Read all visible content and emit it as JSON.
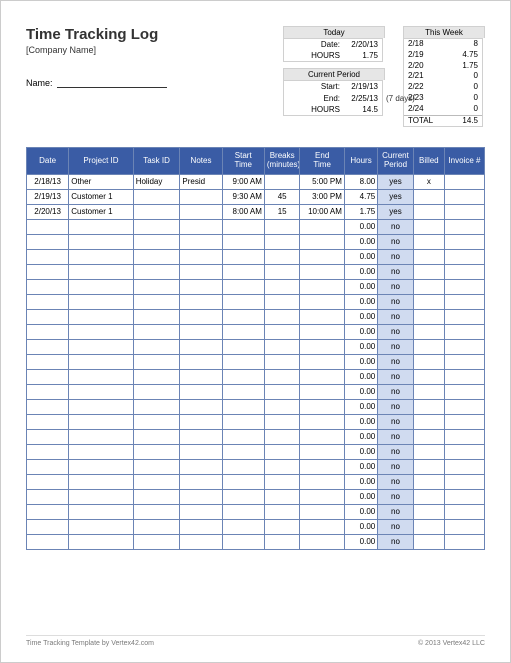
{
  "title": "Time Tracking Log",
  "company": "[Company Name]",
  "name_label": "Name:",
  "today": {
    "title": "Today",
    "date_label": "Date:",
    "date": "2/20/13",
    "hours_label": "HOURS",
    "hours": "1.75"
  },
  "current_period": {
    "title": "Current Period",
    "start_label": "Start:",
    "start": "2/19/13",
    "end_label": "End:",
    "end": "2/25/13",
    "days_note": "(7 days)",
    "hours_label": "HOURS",
    "hours": "14.5"
  },
  "this_week": {
    "title": "This Week",
    "rows": [
      {
        "d": "2/18",
        "v": "8"
      },
      {
        "d": "2/19",
        "v": "4.75"
      },
      {
        "d": "2/20",
        "v": "1.75"
      },
      {
        "d": "2/21",
        "v": "0"
      },
      {
        "d": "2/22",
        "v": "0"
      },
      {
        "d": "2/23",
        "v": "0"
      },
      {
        "d": "2/24",
        "v": "0"
      }
    ],
    "total_label": "TOTAL",
    "total": "14.5"
  },
  "columns": [
    "Date",
    "Project ID",
    "Task ID",
    "Notes",
    "Start Time",
    "Breaks (minutes)",
    "End Time",
    "Hours",
    "Current Period",
    "Billed",
    "Invoice #"
  ],
  "rows": [
    {
      "date": "2/18/13",
      "project": "Other",
      "task": "Holiday",
      "notes": "Presid",
      "start": "9:00 AM",
      "breaks": "",
      "end": "5:00 PM",
      "hours": "8.00",
      "cp": "yes",
      "billed": "x",
      "inv": ""
    },
    {
      "date": "2/19/13",
      "project": "Customer 1",
      "task": "",
      "notes": "",
      "start": "9:30 AM",
      "breaks": "45",
      "end": "3:00 PM",
      "hours": "4.75",
      "cp": "yes",
      "billed": "",
      "inv": ""
    },
    {
      "date": "2/20/13",
      "project": "Customer 1",
      "task": "",
      "notes": "",
      "start": "8:00 AM",
      "breaks": "15",
      "end": "10:00 AM",
      "hours": "1.75",
      "cp": "yes",
      "billed": "",
      "inv": ""
    }
  ],
  "empty_rows": 22,
  "empty_hours": "0.00",
  "empty_cp": "no",
  "footer_left": "Time Tracking Template by Vertex42.com",
  "footer_right": "© 2013 Vertex42 LLC"
}
